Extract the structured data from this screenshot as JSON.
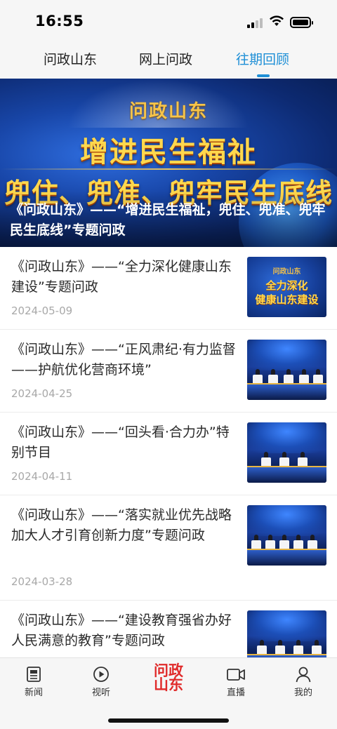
{
  "status_bar": {
    "time": "16:55",
    "icons": [
      "signal-icon",
      "wifi-icon",
      "battery-icon"
    ]
  },
  "tabs": [
    {
      "label": "问政山东",
      "active": false
    },
    {
      "label": "网上问政",
      "active": false
    },
    {
      "label": "往期回顾",
      "active": true
    }
  ],
  "accent_color": "#1e8fd6",
  "brand_red": "#e02a2a",
  "banner": {
    "logo_text": "问政山东",
    "headline_1": "增进民生福祉",
    "headline_2": "兜住、兜准、兜牢民生底线",
    "caption": "《问政山东》——“增进民生福祉，兜住、兜准、兜牢民生底线”专题问政"
  },
  "items": [
    {
      "title": "《问政山东》——“全力深化健康山东建设”专题问政",
      "date": "2024-05-09",
      "thumb": {
        "type": "title-card",
        "logo": "问政山东",
        "line1": "全力深化",
        "line2": "健康山东建设"
      }
    },
    {
      "title": "《问政山东》——“正风肃纪·有力监督——护航优化营商环境”",
      "date": "2024-04-25",
      "thumb": {
        "type": "stage"
      }
    },
    {
      "title": "《问政山东》——“回头看·合力办”特别节目",
      "date": "2024-04-11",
      "thumb": {
        "type": "stage"
      }
    },
    {
      "title": "《问政山东》——“落实就业优先战略 加大人才引育创新力度”专题问政",
      "date": "2024-03-28",
      "thumb": {
        "type": "stage"
      }
    },
    {
      "title": "《问政山东》——“建设教育强省办好人民满意的教育”专题问政",
      "date": "",
      "thumb": {
        "type": "stage"
      }
    }
  ],
  "bottom_nav": {
    "news": {
      "label": "新闻",
      "icon": "news-icon"
    },
    "video": {
      "label": "视听",
      "icon": "play-icon"
    },
    "center": {
      "line1": "问政",
      "line2": "山东",
      "icon": "wenzheng-logo"
    },
    "live": {
      "label": "直播",
      "icon": "camera-icon"
    },
    "mine": {
      "label": "我的",
      "icon": "person-icon"
    }
  }
}
